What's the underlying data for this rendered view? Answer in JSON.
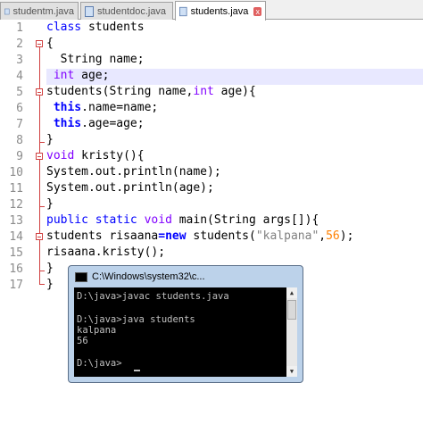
{
  "tabs": [
    {
      "label": "studentm.java",
      "active": false
    },
    {
      "label": "studentdoc.java",
      "active": false
    },
    {
      "label": "students.java",
      "active": true
    }
  ],
  "tab_close_glyph": "x",
  "line_numbers": [
    "1",
    "2",
    "3",
    "4",
    "5",
    "6",
    "7",
    "8",
    "9",
    "10",
    "11",
    "12",
    "13",
    "14",
    "15",
    "16",
    "17"
  ],
  "code": {
    "l1": {
      "kw": "class",
      "rest": " students"
    },
    "l2": {
      "text": "{"
    },
    "l3": {
      "text": "  String name;"
    },
    "l4": {
      "pre": " ",
      "kw": "int",
      "rest": " age;"
    },
    "l5": {
      "pre": "students(String name,",
      "kw": "int",
      "rest": " age){"
    },
    "l6": {
      "pre": " ",
      "kw": "this",
      "rest": ".name=name;"
    },
    "l7": {
      "pre": " ",
      "kw": "this",
      "rest": ".age=age;"
    },
    "l8": {
      "text": "}"
    },
    "l9": {
      "kw": "void",
      "rest": " kristy(){"
    },
    "l10": {
      "text": "System.out.println(name);"
    },
    "l11": {
      "text": "System.out.println(age);"
    },
    "l12": {
      "text": "}"
    },
    "l13": {
      "kw1": "public",
      "kw2": "static",
      "kw3": "void",
      "rest": " main(String args[]){"
    },
    "l14": {
      "pre": "students risaana",
      "op": "=",
      "kw": "new",
      "mid": " students(",
      "str": "\"kalpana\"",
      "sep": ",",
      "num": "56",
      "end": ");"
    },
    "l15": {
      "text": "risaana.kristy();"
    },
    "l16": {
      "text": "}"
    },
    "l17": {
      "text": "}"
    }
  },
  "console": {
    "title": "C:\\Windows\\system32\\c...",
    "lines": [
      "D:\\java>javac students.java",
      "",
      "D:\\java>java students",
      "kalpana",
      "56",
      "",
      "D:\\java>"
    ]
  },
  "colors": {
    "keyword": "#0000ff",
    "string": "#808080",
    "number": "#ff8000",
    "fold_marker": "#d04040",
    "current_line": "#e8e8ff"
  }
}
